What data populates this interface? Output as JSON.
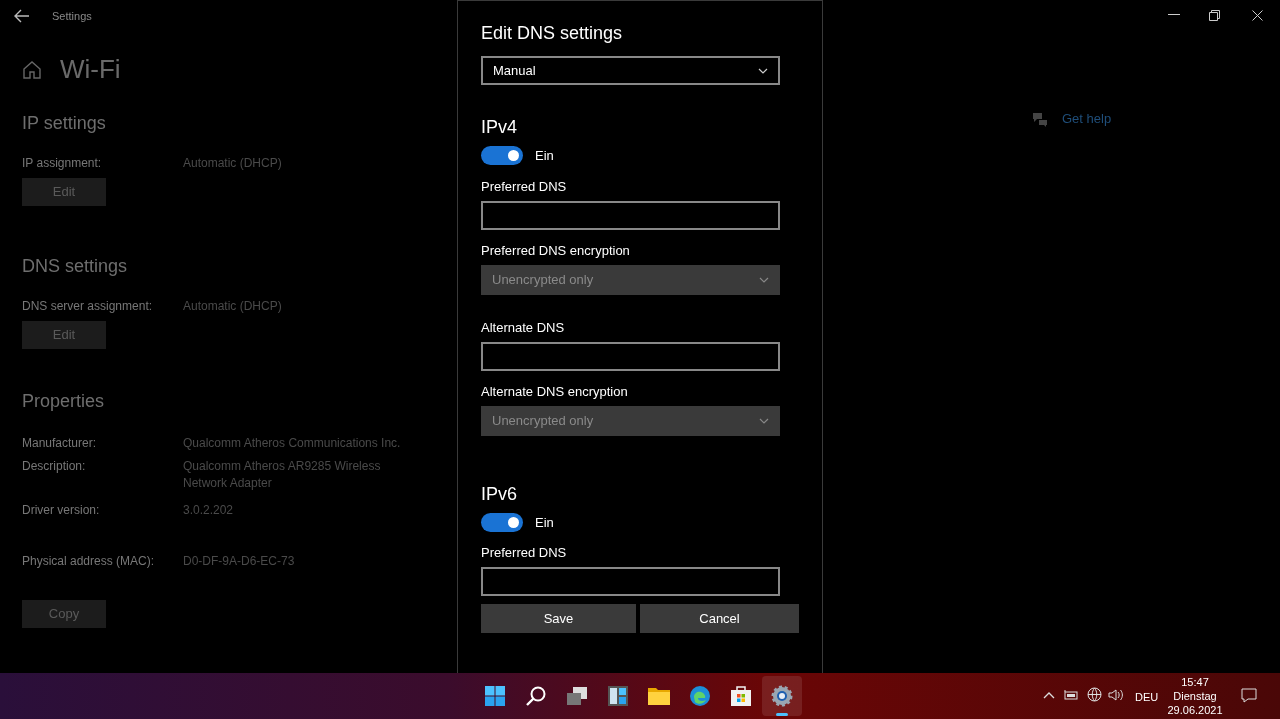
{
  "window": {
    "title": "Settings",
    "heading": "Wi-Fi"
  },
  "sections": [
    {
      "title": "IP settings",
      "rows": [
        {
          "label": "IP assignment:",
          "value": "Automatic (DHCP)"
        }
      ],
      "button": "Edit"
    },
    {
      "title": "DNS settings",
      "rows": [
        {
          "label": "DNS server assignment:",
          "value": "Automatic (DHCP)"
        }
      ],
      "button": "Edit"
    },
    {
      "title": "Properties",
      "rows": [
        {
          "label": "Manufacturer:",
          "value": "Qualcomm Atheros Communications Inc."
        },
        {
          "label": "Description:",
          "value": "Qualcomm Atheros AR9285 Wireless Network Adapter"
        },
        {
          "label": "Driver version:",
          "value": "3.0.2.202"
        },
        {
          "label": "Physical address (MAC):",
          "value": "D0-DF-9A-D6-EC-73"
        }
      ],
      "button": "Copy"
    }
  ],
  "help": {
    "label": "Get help"
  },
  "dialog": {
    "title": "Edit DNS settings",
    "mode": "Manual",
    "groups": [
      {
        "title": "IPv4",
        "toggle": {
          "on": true,
          "label": "Ein"
        },
        "fields": [
          {
            "kind": "input",
            "label": "Preferred DNS"
          },
          {
            "kind": "select",
            "label": "Preferred DNS encryption",
            "value": "Unencrypted only",
            "disabled": true
          },
          {
            "kind": "input",
            "label": "Alternate DNS"
          },
          {
            "kind": "select",
            "label": "Alternate DNS encryption",
            "value": "Unencrypted only",
            "disabled": true
          }
        ]
      },
      {
        "title": "IPv6",
        "toggle": {
          "on": true,
          "label": "Ein"
        },
        "fields": [
          {
            "kind": "input",
            "label": "Preferred DNS"
          }
        ]
      }
    ],
    "buttons": [
      "Save",
      "Cancel"
    ]
  },
  "taskbar": {
    "apps": [
      {
        "kind": "start",
        "selected": false
      },
      {
        "kind": "search",
        "selected": false
      },
      {
        "kind": "taskview",
        "selected": false
      },
      {
        "kind": "widgets",
        "selected": false
      },
      {
        "kind": "folder",
        "selected": false
      },
      {
        "kind": "browser",
        "selected": false
      },
      {
        "kind": "store",
        "selected": false
      },
      {
        "kind": "settings",
        "selected": true
      }
    ],
    "language": "DEU",
    "time": "15:47",
    "day": "Dienstag",
    "date": "29.06.2021"
  }
}
